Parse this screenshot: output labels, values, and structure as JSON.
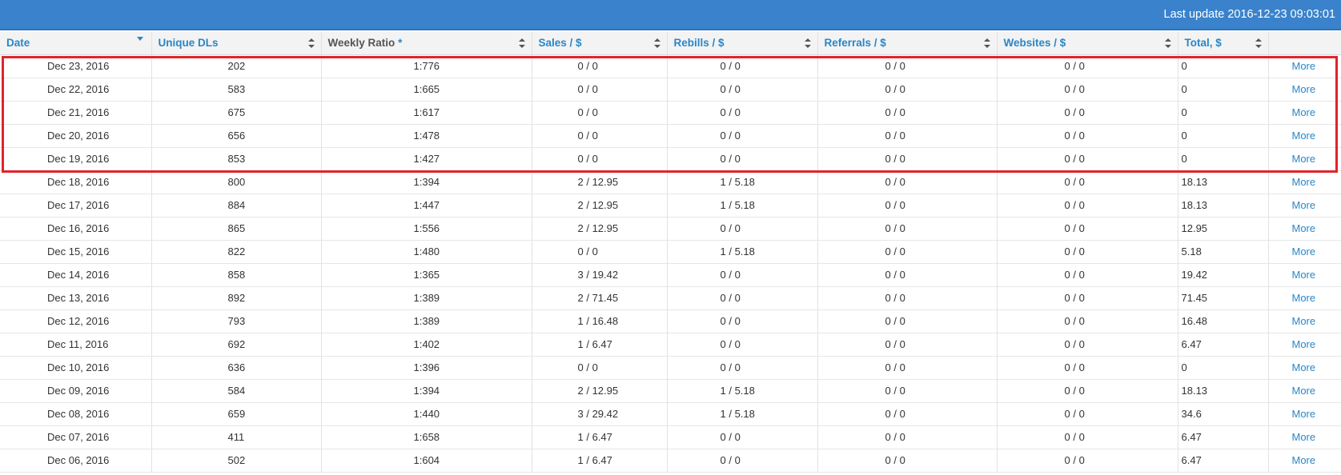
{
  "topbar": {
    "last_update": "Last update 2016-12-23 09:03:01"
  },
  "columns": {
    "date": "Date",
    "unique": "Unique DLs",
    "ratio": "Weekly Ratio",
    "ratio_star": "*",
    "sales": "Sales / $",
    "rebills": "Rebills / $",
    "referrals": "Referrals / $",
    "websites": "Websites / $",
    "total": "Total, $"
  },
  "more_label": "More",
  "rows": [
    {
      "date": "Dec 23, 2016",
      "unique": "202",
      "ratio": "1:776",
      "sales": "0 / 0",
      "rebills": "0 / 0",
      "referrals": "0 / 0",
      "websites": "0 / 0",
      "total": "0"
    },
    {
      "date": "Dec 22, 2016",
      "unique": "583",
      "ratio": "1:665",
      "sales": "0 / 0",
      "rebills": "0 / 0",
      "referrals": "0 / 0",
      "websites": "0 / 0",
      "total": "0"
    },
    {
      "date": "Dec 21, 2016",
      "unique": "675",
      "ratio": "1:617",
      "sales": "0 / 0",
      "rebills": "0 / 0",
      "referrals": "0 / 0",
      "websites": "0 / 0",
      "total": "0"
    },
    {
      "date": "Dec 20, 2016",
      "unique": "656",
      "ratio": "1:478",
      "sales": "0 / 0",
      "rebills": "0 / 0",
      "referrals": "0 / 0",
      "websites": "0 / 0",
      "total": "0"
    },
    {
      "date": "Dec 19, 2016",
      "unique": "853",
      "ratio": "1:427",
      "sales": "0 / 0",
      "rebills": "0 / 0",
      "referrals": "0 / 0",
      "websites": "0 / 0",
      "total": "0"
    },
    {
      "date": "Dec 18, 2016",
      "unique": "800",
      "ratio": "1:394",
      "sales": "2 / 12.95",
      "rebills": "1 / 5.18",
      "referrals": "0 / 0",
      "websites": "0 / 0",
      "total": "18.13"
    },
    {
      "date": "Dec 17, 2016",
      "unique": "884",
      "ratio": "1:447",
      "sales": "2 / 12.95",
      "rebills": "1 / 5.18",
      "referrals": "0 / 0",
      "websites": "0 / 0",
      "total": "18.13"
    },
    {
      "date": "Dec 16, 2016",
      "unique": "865",
      "ratio": "1:556",
      "sales": "2 / 12.95",
      "rebills": "0 / 0",
      "referrals": "0 / 0",
      "websites": "0 / 0",
      "total": "12.95"
    },
    {
      "date": "Dec 15, 2016",
      "unique": "822",
      "ratio": "1:480",
      "sales": "0 / 0",
      "rebills": "1 / 5.18",
      "referrals": "0 / 0",
      "websites": "0 / 0",
      "total": "5.18"
    },
    {
      "date": "Dec 14, 2016",
      "unique": "858",
      "ratio": "1:365",
      "sales": "3 / 19.42",
      "rebills": "0 / 0",
      "referrals": "0 / 0",
      "websites": "0 / 0",
      "total": "19.42"
    },
    {
      "date": "Dec 13, 2016",
      "unique": "892",
      "ratio": "1:389",
      "sales": "2 / 71.45",
      "rebills": "0 / 0",
      "referrals": "0 / 0",
      "websites": "0 / 0",
      "total": "71.45"
    },
    {
      "date": "Dec 12, 2016",
      "unique": "793",
      "ratio": "1:389",
      "sales": "1 / 16.48",
      "rebills": "0 / 0",
      "referrals": "0 / 0",
      "websites": "0 / 0",
      "total": "16.48"
    },
    {
      "date": "Dec 11, 2016",
      "unique": "692",
      "ratio": "1:402",
      "sales": "1 / 6.47",
      "rebills": "0 / 0",
      "referrals": "0 / 0",
      "websites": "0 / 0",
      "total": "6.47"
    },
    {
      "date": "Dec 10, 2016",
      "unique": "636",
      "ratio": "1:396",
      "sales": "0 / 0",
      "rebills": "0 / 0",
      "referrals": "0 / 0",
      "websites": "0 / 0",
      "total": "0"
    },
    {
      "date": "Dec 09, 2016",
      "unique": "584",
      "ratio": "1:394",
      "sales": "2 / 12.95",
      "rebills": "1 / 5.18",
      "referrals": "0 / 0",
      "websites": "0 / 0",
      "total": "18.13"
    },
    {
      "date": "Dec 08, 2016",
      "unique": "659",
      "ratio": "1:440",
      "sales": "3 / 29.42",
      "rebills": "1 / 5.18",
      "referrals": "0 / 0",
      "websites": "0 / 0",
      "total": "34.6"
    },
    {
      "date": "Dec 07, 2016",
      "unique": "411",
      "ratio": "1:658",
      "sales": "1 / 6.47",
      "rebills": "0 / 0",
      "referrals": "0 / 0",
      "websites": "0 / 0",
      "total": "6.47"
    },
    {
      "date": "Dec 06, 2016",
      "unique": "502",
      "ratio": "1:604",
      "sales": "1 / 6.47",
      "rebills": "0 / 0",
      "referrals": "0 / 0",
      "websites": "0 / 0",
      "total": "6.47"
    }
  ]
}
